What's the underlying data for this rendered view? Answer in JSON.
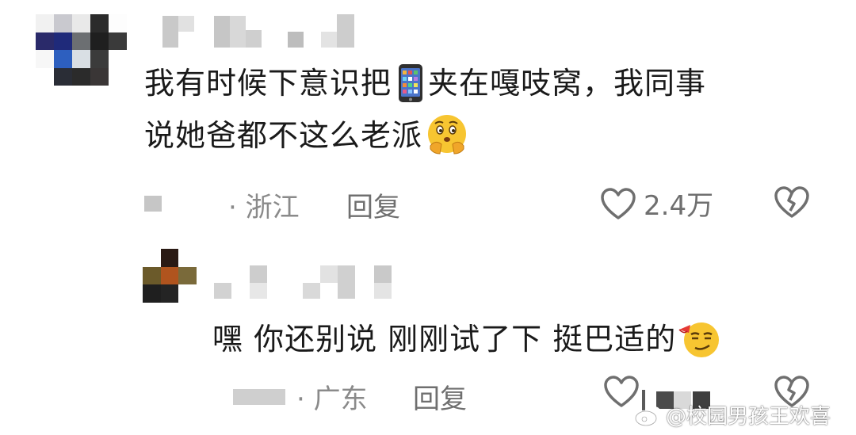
{
  "comment": {
    "text_line1_a": "我有时候下意识把",
    "text_line1_b": "夹在嘎吱窝，我同事",
    "text_line2": "说她爸都不这么老派",
    "emoji_phone": "📱",
    "location": "· 浙江",
    "reply_label": "回复",
    "like_count": "2.4万"
  },
  "reply": {
    "text": "嘿 你还别说 刚刚试了下 挺巴适的",
    "location": "· 广东",
    "reply_label": "回复"
  },
  "watermark": {
    "text": "@校园男孩王欢喜"
  },
  "colors": {
    "text": "#1a1a1a",
    "meta": "#8a8a8a",
    "icon": "#6f6f6f",
    "emoji_yellow": "#f7c531"
  }
}
